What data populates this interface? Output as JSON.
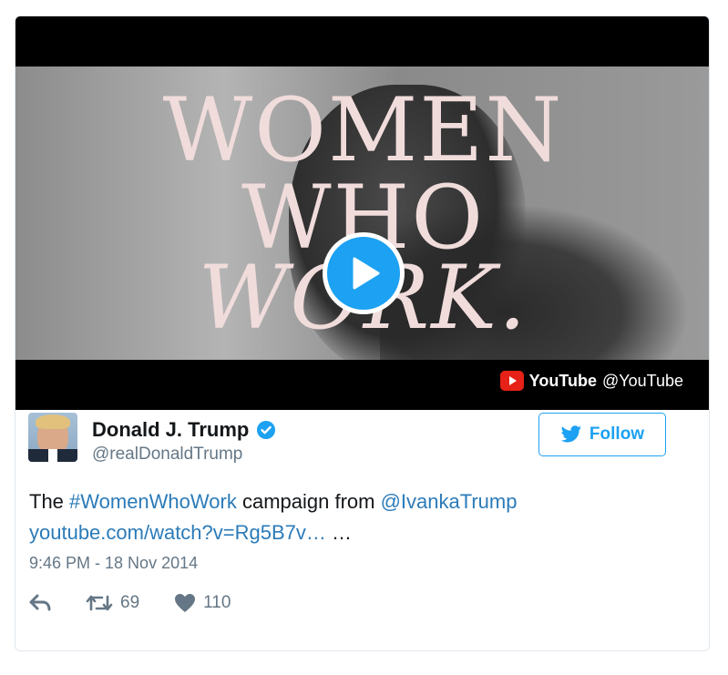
{
  "video": {
    "title_lines": [
      "WOMEN",
      "WHO",
      "WORK."
    ],
    "source_name": "YouTube",
    "source_handle": "@YouTube"
  },
  "user": {
    "display_name": "Donald J. Trump",
    "handle": "@realDonaldTrump",
    "follow_label": "Follow"
  },
  "tweet": {
    "text_prefix": "The ",
    "hashtag": "#WomenWhoWork",
    "text_middle": " campaign from ",
    "mention": "@IvankaTrump",
    "link": "youtube.com/watch?v=Rg5B7v…",
    "text_suffix": " …",
    "timestamp": "9:46 PM - 18 Nov 2014"
  },
  "actions": {
    "reply_icon": "reply-icon",
    "retweet_icon": "retweet-icon",
    "like_icon": "heart-icon",
    "retweet_count": "69",
    "like_count": "110"
  },
  "colors": {
    "accent": "#1da1f2",
    "link": "#2b7bb9",
    "muted": "#657786",
    "youtube_red": "#e62117",
    "title_pink": "#f1dcdc"
  }
}
